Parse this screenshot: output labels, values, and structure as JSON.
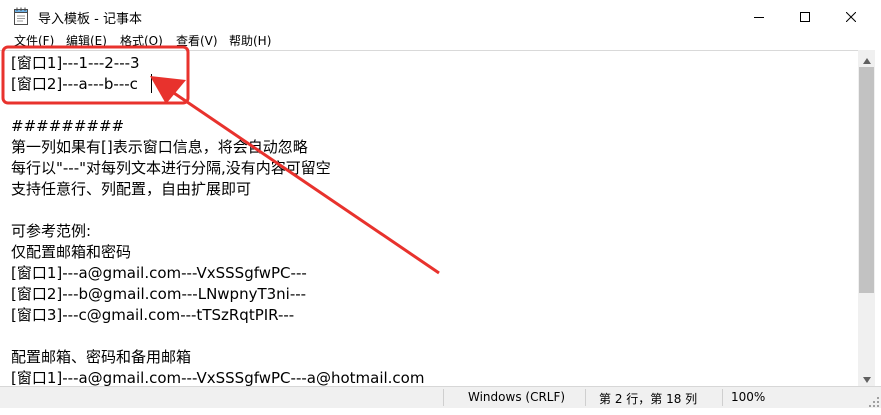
{
  "window": {
    "title": "导入模板 - 记事本"
  },
  "menu": [
    {
      "label": "文件(F)"
    },
    {
      "label": "编辑(E)"
    },
    {
      "label": "格式(O)"
    },
    {
      "label": "查看(V)"
    },
    {
      "label": "帮助(H)"
    }
  ],
  "editor": {
    "lines": [
      "[窗口1]---1---2---3",
      "[窗口2]---a---b---c",
      "",
      "#########",
      "第一列如果有[]表示窗口信息，将会自动忽略",
      "每行以\"---\"对每列文本进行分隔,没有内容可留空",
      "支持任意行、列配置，自由扩展即可",
      "",
      "可参考范例:",
      "仅配置邮箱和密码",
      "[窗口1]---a@gmail.com---VxSSSgfwPC---",
      "[窗口2]---b@gmail.com---LNwpnyT3ni---",
      "[窗口3]---c@gmail.com---tTSzRqtPIR---",
      "",
      "配置邮箱、密码和备用邮箱",
      "[窗口1]---a@gmail.com---VxSSSgfwPC---a@hotmail.com"
    ]
  },
  "statusbar": {
    "encoding": "Windows (CRLF)",
    "position": "第 2 行，第 18 列",
    "zoom": "100%"
  },
  "colors": {
    "annotation": "#e8322d"
  },
  "icons": {
    "app": "notepad-icon",
    "minimize": "minimize-icon",
    "maximize": "maximize-icon",
    "close": "close-icon"
  }
}
